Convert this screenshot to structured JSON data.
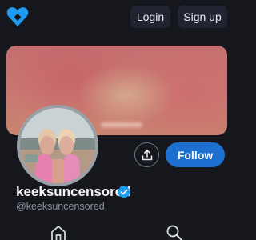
{
  "app": {
    "logo_icon": "diamond-heart-logo-icon",
    "brand_color": "#1d9bf0"
  },
  "header": {
    "login_label": "Login",
    "signup_label": "Sign up"
  },
  "profile": {
    "username": "keeksuncensored",
    "handle": "@keeksuncensored",
    "verified_icon": "verified-check-icon",
    "follow_label": "Follow",
    "share_icon": "share-upload-icon",
    "avatar_alt": "profile-avatar",
    "banner": "profile-banner"
  },
  "nav": {
    "items": [
      {
        "icon": "home-icon"
      },
      {
        "icon": "search-icon"
      }
    ]
  },
  "colors": {
    "background": "#15171c",
    "follow_button": "#1d6fd0",
    "top_button": "#1f2430",
    "handle_text": "#8a919c"
  }
}
